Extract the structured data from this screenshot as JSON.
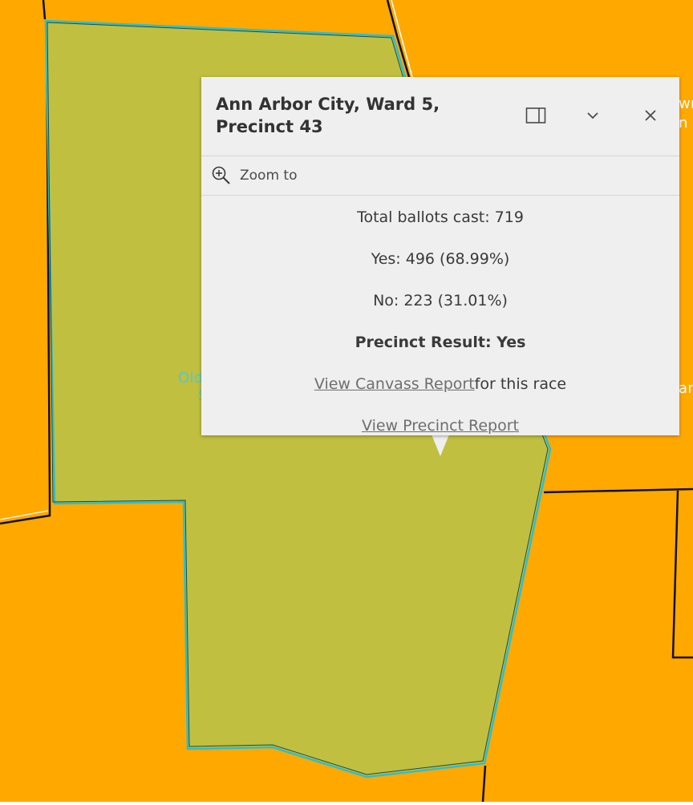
{
  "map": {
    "colors": {
      "background": "#ffa800",
      "selected_fill": "#c0bf40",
      "selected_outline": "#2bbfcf",
      "boundary": "#111111"
    },
    "labels": [
      "Old",
      "S",
      "wn",
      "n A",
      "an"
    ]
  },
  "popup": {
    "title": "Ann Arbor City, Ward 5, Precinct 43",
    "buttons": {
      "dock_icon": "dock-side-icon",
      "collapse_icon": "chevron-down-icon",
      "close_icon": "close-icon"
    },
    "actions": {
      "zoom_to": "Zoom to",
      "zoom_icon": "zoom-in-magnifier-icon"
    },
    "content": {
      "total_ballots": "Total ballots cast: 719",
      "yes": "Yes: 496 (68.99%)",
      "no": "No: 223 (31.01%)",
      "result": "Precinct Result: Yes",
      "canvass_link": "View Canvass Report",
      "canvass_suffix": "for this race",
      "precinct_link": "View Precinct Report"
    }
  }
}
